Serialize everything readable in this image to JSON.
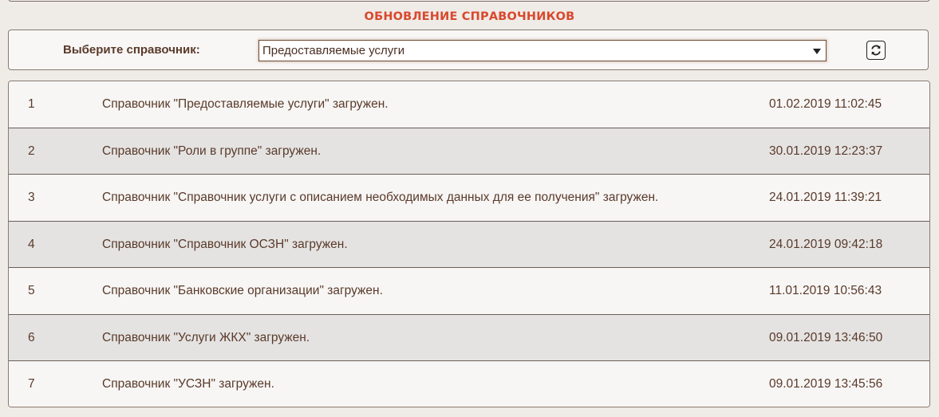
{
  "header": {
    "title": "ОБНОВЛЕНИЕ СПРАВОЧНИКОВ"
  },
  "selector": {
    "label": "Выберите справочник:",
    "selected_value": "Предоставляемые услуги",
    "refresh_icon": "refresh-icon"
  },
  "log": {
    "rows": [
      {
        "num": "1",
        "message": "Справочник \"Предоставляемые услуги\" загружен.",
        "datetime": "01.02.2019 11:02:45"
      },
      {
        "num": "2",
        "message": "Справочник \"Роли в группе\" загружен.",
        "datetime": "30.01.2019 12:23:37"
      },
      {
        "num": "3",
        "message": "Справочник \"Справочник услуги с описанием необходимых данных для ее получения\" загружен.",
        "datetime": "24.01.2019 11:39:21"
      },
      {
        "num": "4",
        "message": "Справочник \"Справочник ОСЗН\" загружен.",
        "datetime": "24.01.2019 09:42:18"
      },
      {
        "num": "5",
        "message": "Справочник \"Банковские организации\" загружен.",
        "datetime": "11.01.2019 10:56:43"
      },
      {
        "num": "6",
        "message": "Справочник \"Услуги ЖКХ\" загружен.",
        "datetime": "09.01.2019 13:46:50"
      },
      {
        "num": "7",
        "message": "Справочник \"УСЗН\" загружен.",
        "datetime": "09.01.2019 13:45:56"
      }
    ]
  },
  "colors": {
    "title": "#d9482d",
    "text": "#5a3a2a",
    "row_light": "#f7f6f5",
    "row_dark": "#e4e3e2",
    "background": "#efebe7"
  }
}
